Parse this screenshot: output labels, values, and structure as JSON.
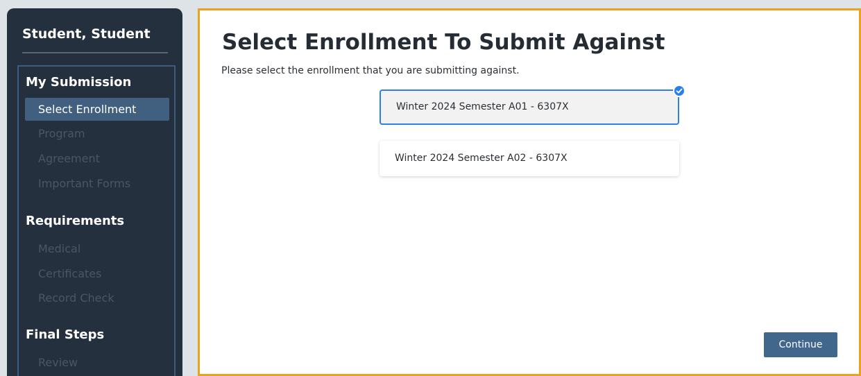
{
  "sidebar": {
    "student_name": "Student, Student",
    "sections": [
      {
        "heading": "My Submission",
        "items": [
          "Select Enrollment",
          "Program",
          "Agreement",
          "Important Forms"
        ]
      },
      {
        "heading": "Requirements",
        "items": [
          "Medical",
          "Certificates",
          "Record Check"
        ]
      },
      {
        "heading": "Final Steps",
        "items": [
          "Review"
        ]
      }
    ],
    "active_item": "Select Enrollment"
  },
  "main": {
    "title": "Select Enrollment To Submit Against",
    "subtitle": "Please select the enrollment that you are submitting against.",
    "options": [
      {
        "label": "Winter 2024 Semester A01 - 6307X",
        "selected": true
      },
      {
        "label": "Winter 2024 Semester A02 - 6307X",
        "selected": false
      }
    ],
    "continue_label": "Continue"
  },
  "colors": {
    "accent": "#eba31f",
    "selected_border": "#2a80e8",
    "sidebar_bg": "#25303e",
    "button_bg": "#41678d"
  }
}
